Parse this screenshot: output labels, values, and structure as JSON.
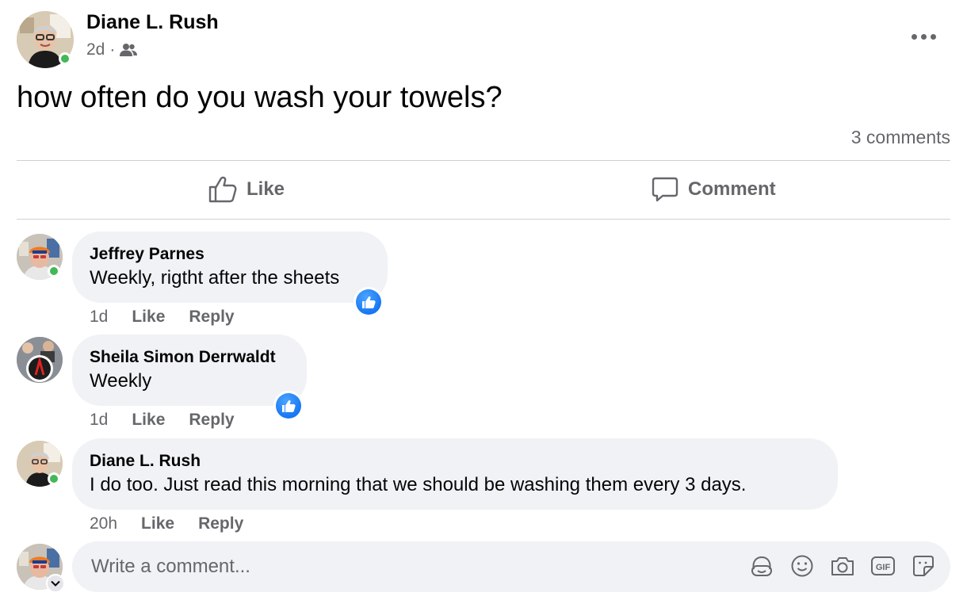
{
  "post": {
    "author": "Diane L. Rush",
    "time": "2d",
    "separator": "·",
    "audience_icon": "friends-icon",
    "text": "how often do you wash your towels?",
    "comment_count": "3 comments",
    "more_icon": "more-options-icon"
  },
  "actions": {
    "like_label": "Like",
    "comment_label": "Comment"
  },
  "comments": [
    {
      "name": "Jeffrey Parnes",
      "text": "Weekly, rigtht after the sheets",
      "time": "1d",
      "like": "Like",
      "reply": "Reply",
      "reaction": "like"
    },
    {
      "name": "Sheila Simon Derrwaldt",
      "text": "Weekly",
      "time": "1d",
      "like": "Like",
      "reply": "Reply",
      "reaction": "like"
    },
    {
      "name": "Diane L. Rush",
      "text": "I do too. Just read this morning that we should be washing them every 3 days.",
      "time": "20h",
      "like": "Like",
      "reply": "Reply"
    }
  ],
  "composer": {
    "placeholder": "Write a comment...",
    "tools": [
      "avatar-sticker-icon",
      "emoji-icon",
      "camera-icon",
      "gif-icon",
      "sticker-icon"
    ]
  },
  "colors": {
    "accent": "#1877f2",
    "online": "#44b757",
    "bubble": "#f0f2f5",
    "secondary_text": "#65676b"
  }
}
